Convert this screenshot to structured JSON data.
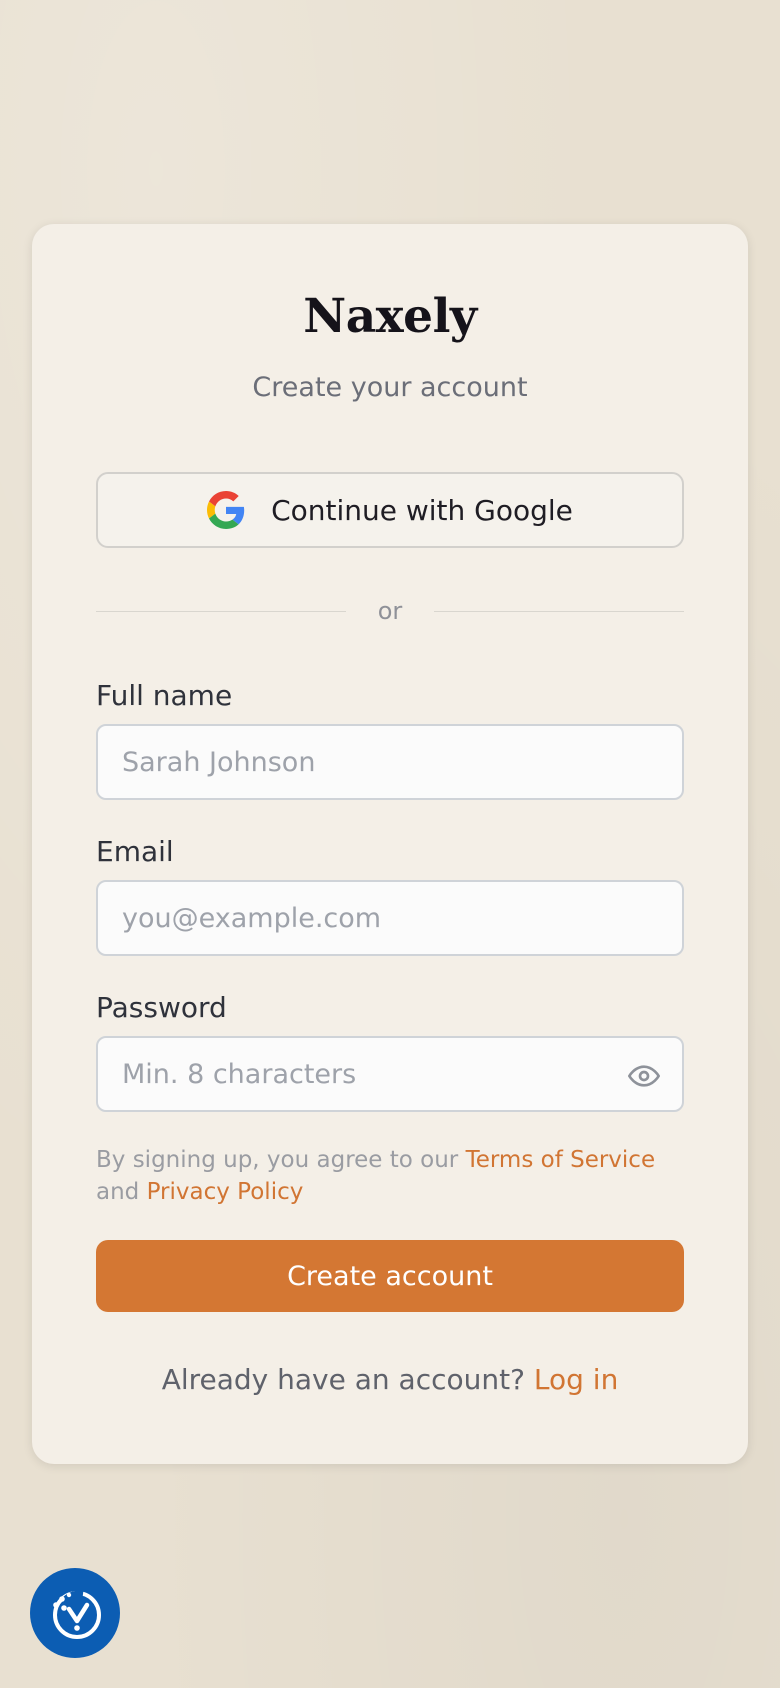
{
  "brand": {
    "name": "Naxely"
  },
  "header": {
    "subtitle": "Create your account"
  },
  "google_button": {
    "label": "Continue with Google",
    "icon": "google-icon"
  },
  "divider": {
    "text": "or"
  },
  "form": {
    "full_name": {
      "label": "Full name",
      "placeholder": "Sarah Johnson",
      "value": ""
    },
    "email": {
      "label": "Email",
      "placeholder": "you@example.com",
      "value": ""
    },
    "password": {
      "label": "Password",
      "placeholder": "Min. 8 characters",
      "value": "",
      "toggle_icon": "eye-icon"
    }
  },
  "terms": {
    "prefix": "By signing up, you agree to our",
    "terms_link": "Terms of Service",
    "conjunction": "and",
    "privacy_link": "Privacy Policy"
  },
  "submit": {
    "label": "Create account"
  },
  "footer": {
    "prompt": "Already have an account?",
    "login_link": "Log in"
  },
  "floating_button": {
    "icon": "accessibility-check-icon"
  },
  "colors": {
    "accent": "#d47733",
    "link": "#d17533",
    "floating_button": "#0c5db3",
    "background": "#e8e0d1",
    "card": "#f4efe7"
  }
}
